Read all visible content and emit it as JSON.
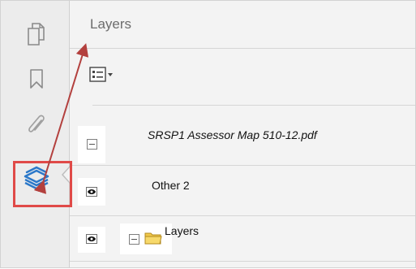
{
  "panel": {
    "title": "Layers",
    "options_icon": "list-options-icon",
    "tree": [
      {
        "label": "SRSP1 Assessor Map 510-12.pdf",
        "italic": true,
        "expanded": true
      },
      {
        "label": "Other 2",
        "visible_icon": "eye-icon"
      },
      {
        "label": "Layers",
        "visible_icon": "eye-icon",
        "icon": "folder-icon",
        "expanded": true
      }
    ]
  },
  "rail": {
    "items": [
      {
        "name": "page-thumbnails",
        "icon": "pages-icon"
      },
      {
        "name": "bookmarks",
        "icon": "bookmark-icon"
      },
      {
        "name": "attachments",
        "icon": "paperclip-icon"
      },
      {
        "name": "layers",
        "icon": "layers-icon",
        "active": true
      }
    ]
  },
  "colors": {
    "accent_blue": "#2b78c9",
    "highlight_red": "#e04a48",
    "annotation_arrow": "#b3403e"
  }
}
